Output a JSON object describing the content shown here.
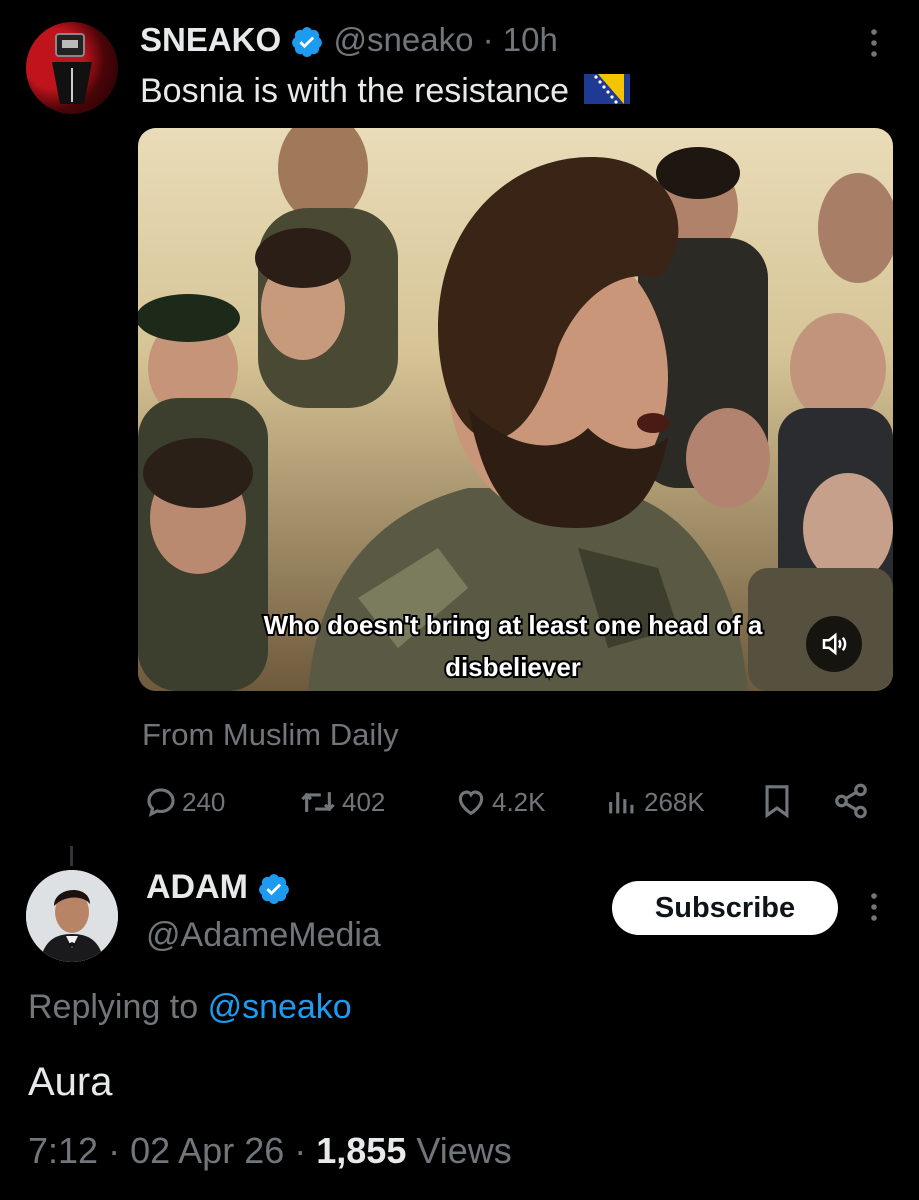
{
  "tweet": {
    "author_name": "SNEAKO",
    "handle": "@sneako",
    "time_sep": "·",
    "time": "10h",
    "text": "Bosnia is with the resistance",
    "flag_icon": "bosnia-flag-icon",
    "video_caption_line1": "Who doesn't bring at least one head of a",
    "video_caption_line2": "disbeliever",
    "source": "From Muslim Daily",
    "stats": {
      "replies": "240",
      "reposts": "402",
      "likes": "4.2K",
      "views": "268K"
    }
  },
  "reply": {
    "author_name": "ADAM",
    "handle": "@AdameMedia",
    "subscribe_label": "Subscribe",
    "replying_prefix": "Replying to",
    "replying_handle": "@sneako",
    "text": "Aura",
    "meta_time": "7:12",
    "meta_sep1": "·",
    "meta_date": "02 Apr 26",
    "meta_sep2": "·",
    "meta_views_count": "1,855",
    "meta_views_label": "Views"
  },
  "colors": {
    "background": "#000000",
    "accent": "#1d9bf0",
    "muted": "#71767b",
    "text": "#e7e9ea"
  }
}
